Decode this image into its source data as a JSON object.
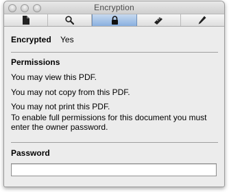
{
  "window": {
    "title": "Encryption"
  },
  "toolbar": {
    "tabs": [
      {
        "icon": "document-icon",
        "active": false
      },
      {
        "icon": "magnifier-icon",
        "active": false
      },
      {
        "icon": "lock-icon",
        "active": true
      },
      {
        "icon": "ruler-icon",
        "active": false
      },
      {
        "icon": "pen-icon",
        "active": false
      }
    ],
    "active_color": "#89b0e0"
  },
  "encryption": {
    "label": "Encrypted",
    "value": "Yes"
  },
  "permissions": {
    "heading": "Permissions",
    "lines": [
      "You may view this PDF.",
      "You may not copy from this PDF.",
      "You may not print this PDF."
    ],
    "note": "To enable full permissions for this document you must enter the owner password."
  },
  "password": {
    "heading": "Password",
    "value": ""
  }
}
